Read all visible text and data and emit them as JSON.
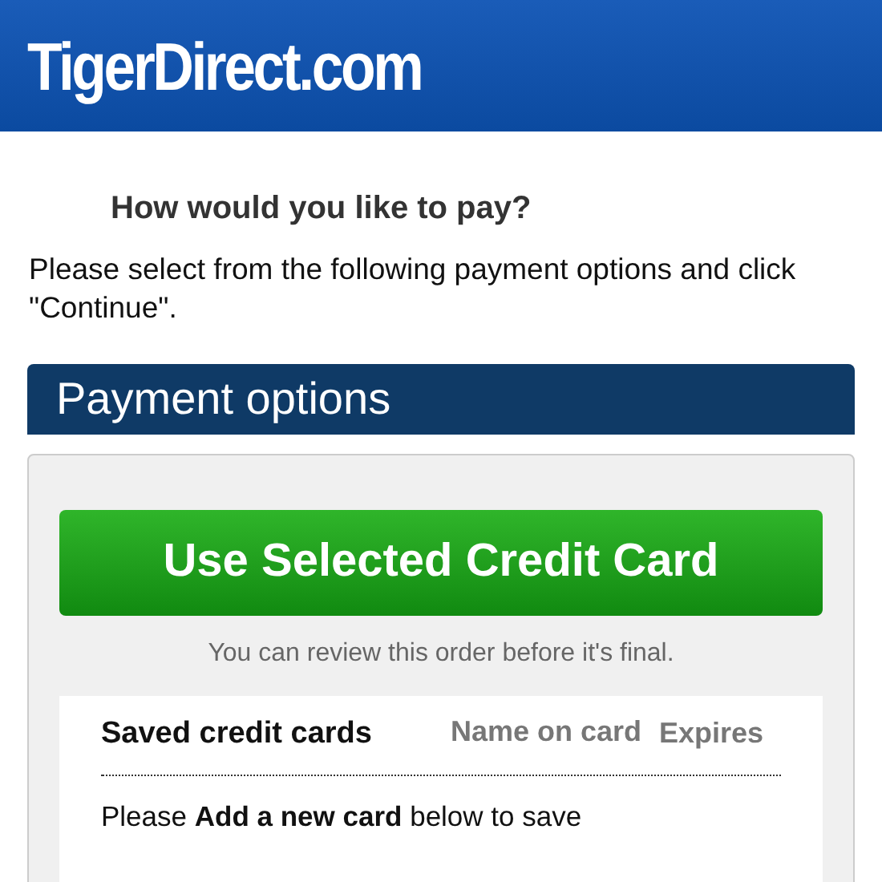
{
  "header": {
    "logo": "TigerDirect.com"
  },
  "heading": "How would you like to pay?",
  "instructions": "Please select from the following payment options and click \"Continue\".",
  "panel": {
    "title": "Payment options",
    "button": "Use Selected Credit Card",
    "note": "You can review this order before it's final.",
    "table": {
      "columns": [
        "Saved credit cards",
        "Name on card",
        "Expires"
      ],
      "message": "Please **Add a new card** below to save"
    }
  }
}
